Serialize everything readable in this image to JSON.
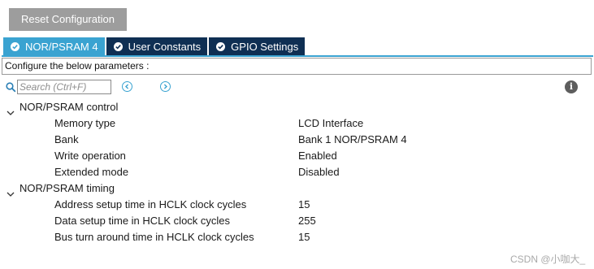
{
  "toolbar": {
    "reset_label": "Reset Configuration"
  },
  "tabs": [
    {
      "label": "NOR/PSRAM 4",
      "active": true
    },
    {
      "label": "User Constants",
      "active": false
    },
    {
      "label": "GPIO Settings",
      "active": false
    }
  ],
  "configure_text": "Configure the below parameters :",
  "search": {
    "placeholder": "Search (Ctrl+F)",
    "value": ""
  },
  "groups": [
    {
      "title": "NOR/PSRAM control",
      "params": [
        {
          "name": "Memory type",
          "value": "LCD Interface"
        },
        {
          "name": "Bank",
          "value": "Bank 1 NOR/PSRAM 4"
        },
        {
          "name": "Write operation",
          "value": "Enabled"
        },
        {
          "name": "Extended mode",
          "value": "Disabled"
        }
      ]
    },
    {
      "title": "NOR/PSRAM timing",
      "params": [
        {
          "name": "Address setup time in HCLK clock cycles",
          "value": "15"
        },
        {
          "name": "Data setup time in HCLK clock cycles",
          "value": "255"
        },
        {
          "name": "Bus turn around time in HCLK clock cycles",
          "value": "15"
        }
      ]
    }
  ],
  "info_icon_glyph": "i",
  "watermark": "CSDN @小咖大_",
  "colors": {
    "tab_active": "#3aa3d1",
    "tab_inactive": "#0f2f53",
    "reset_button": "#9d9d9d"
  }
}
